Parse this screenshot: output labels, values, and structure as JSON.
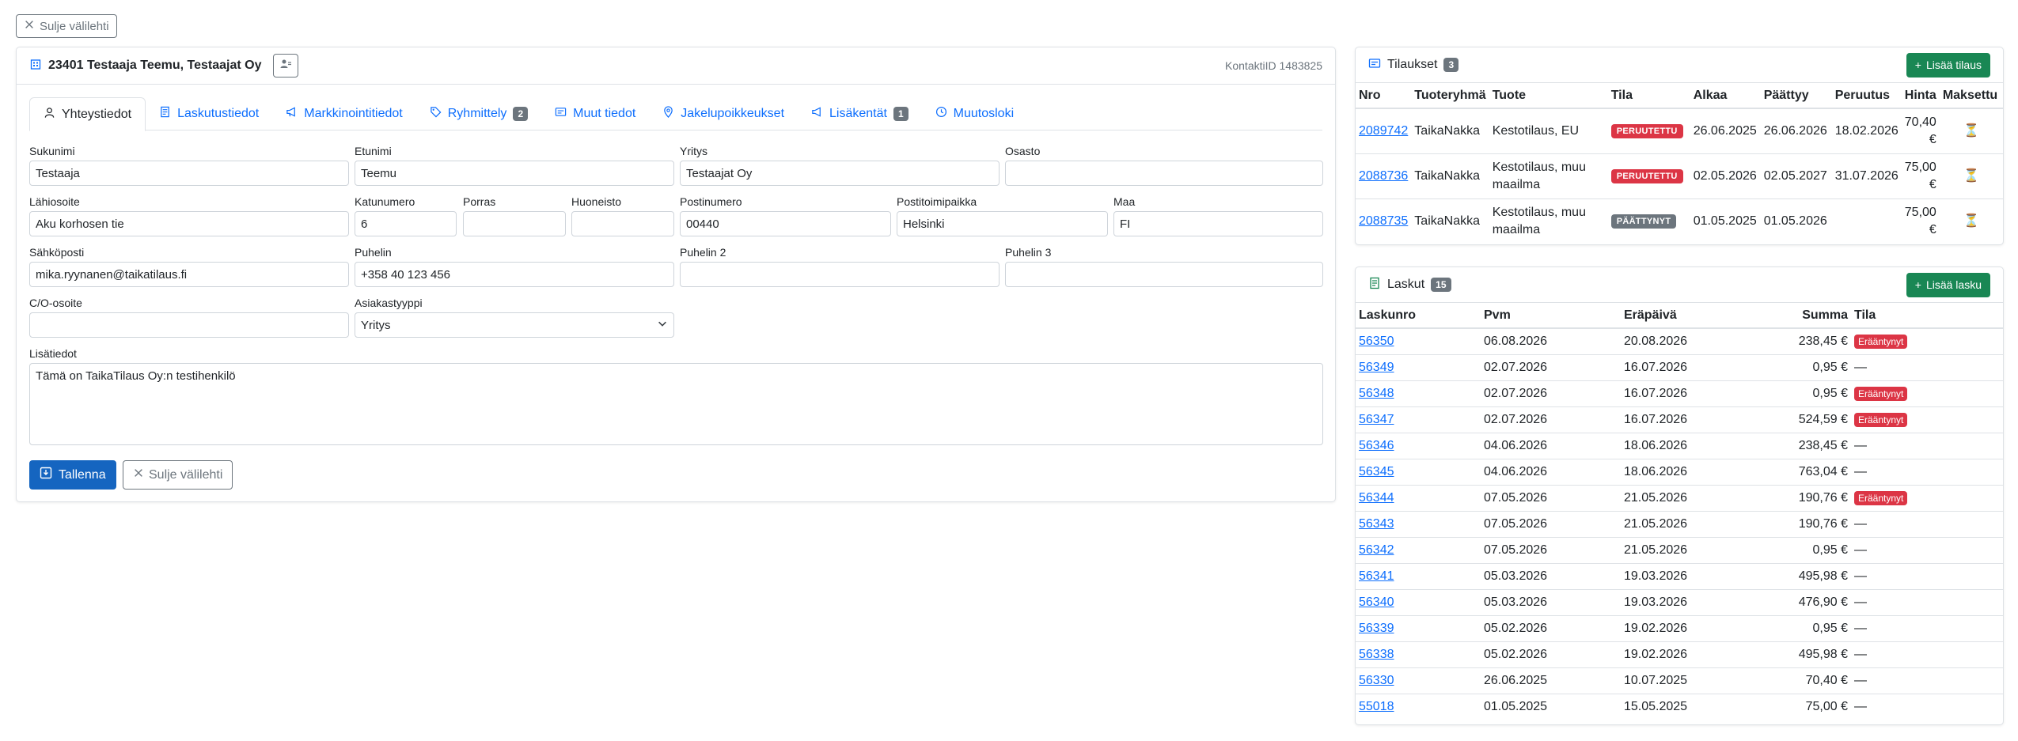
{
  "top_close_label": "Sulje välilehti",
  "contact": {
    "title": "23401 Testaaja Teemu, Testaajat Oy",
    "contact_id": "KontaktiID 1483825"
  },
  "tabs": [
    {
      "label": "Yhteystiedot",
      "icon": "person-icon",
      "active": true
    },
    {
      "label": "Laskutustiedot",
      "icon": "invoice-icon"
    },
    {
      "label": "Markkinointitiedot",
      "icon": "megaphone-icon"
    },
    {
      "label": "Ryhmittely",
      "icon": "tag-icon",
      "badge": "2"
    },
    {
      "label": "Muut tiedot",
      "icon": "card-icon"
    },
    {
      "label": "Jakelupoikkeukset",
      "icon": "location-icon"
    },
    {
      "label": "Lisäkentät",
      "icon": "megaphone-icon",
      "badge": "1"
    },
    {
      "label": "Muutosloki",
      "icon": "clock-icon"
    }
  ],
  "fields": {
    "sukunimi": {
      "label": "Sukunimi",
      "value": "Testaaja"
    },
    "etunimi": {
      "label": "Etunimi",
      "value": "Teemu"
    },
    "yritys": {
      "label": "Yritys",
      "value": "Testaajat Oy"
    },
    "osasto": {
      "label": "Osasto",
      "value": ""
    },
    "lahiosoite": {
      "label": "Lähiosoite",
      "value": "Aku korhosen tie"
    },
    "katunumero": {
      "label": "Katunumero",
      "value": "6"
    },
    "porras": {
      "label": "Porras",
      "value": ""
    },
    "huoneisto": {
      "label": "Huoneisto",
      "value": ""
    },
    "postinumero": {
      "label": "Postinumero",
      "value": "00440"
    },
    "postitoimipaikka": {
      "label": "Postitoimipaikka",
      "value": "Helsinki"
    },
    "maa": {
      "label": "Maa",
      "value": "FI"
    },
    "sahkoposti": {
      "label": "Sähköposti",
      "value": "mika.ryynanen@taikatilaus.fi"
    },
    "puhelin": {
      "label": "Puhelin",
      "value": "+358 40 123 456"
    },
    "puhelin2": {
      "label": "Puhelin 2",
      "value": ""
    },
    "puhelin3": {
      "label": "Puhelin 3",
      "value": ""
    },
    "co_osoite": {
      "label": "C/O-osoite",
      "value": ""
    },
    "asiakastyyppi": {
      "label": "Asiakastyyppi",
      "value": "Yritys"
    },
    "lisatiedot": {
      "label": "Lisätiedot",
      "value": "Tämä on TaikaTilaus Oy:n testihenkilö"
    }
  },
  "buttons": {
    "save": "Tallenna",
    "close": "Sulje välilehti"
  },
  "orders": {
    "title": "Tilaukset",
    "count": "3",
    "add_label": "Lisää tilaus",
    "columns": [
      "Nro",
      "Tuoteryhmä",
      "Tuote",
      "Tila",
      "Alkaa",
      "Päättyy",
      "Peruutus",
      "Hinta",
      "Maksettu"
    ],
    "rows": [
      {
        "nro": "2089742",
        "group": "TaikaNakka",
        "product": "Kestotilaus, EU",
        "status": "PERUUTETTU",
        "status_type": "danger",
        "start": "26.06.2025",
        "end": "26.06.2026",
        "cancel": "18.02.2026",
        "price": "70,40 €"
      },
      {
        "nro": "2088736",
        "group": "TaikaNakka",
        "product": "Kestotilaus, muu maailma",
        "status": "PERUUTETTU",
        "status_type": "danger",
        "start": "02.05.2026",
        "end": "02.05.2027",
        "cancel": "31.07.2026",
        "price": "75,00 €"
      },
      {
        "nro": "2088735",
        "group": "TaikaNakka",
        "product": "Kestotilaus, muu maailma",
        "status": "PÄÄTTYNYT",
        "status_type": "secondary",
        "start": "01.05.2025",
        "end": "01.05.2026",
        "cancel": "",
        "price": "75,00 €"
      }
    ]
  },
  "invoices": {
    "title": "Laskut",
    "count": "15",
    "add_label": "Lisää lasku",
    "columns": [
      "Laskunro",
      "Pvm",
      "Eräpäivä",
      "Summa",
      "Tila"
    ],
    "overdue_label": "Erääntynyt",
    "rows": [
      {
        "nro": "56350",
        "date": "06.08.2026",
        "due": "20.08.2026",
        "sum": "238,45 €",
        "status": "Erääntynyt"
      },
      {
        "nro": "56349",
        "date": "02.07.2026",
        "due": "16.07.2026",
        "sum": "0,95 €",
        "status": "—"
      },
      {
        "nro": "56348",
        "date": "02.07.2026",
        "due": "16.07.2026",
        "sum": "0,95 €",
        "status": "Erääntynyt"
      },
      {
        "nro": "56347",
        "date": "02.07.2026",
        "due": "16.07.2026",
        "sum": "524,59 €",
        "status": "Erääntynyt"
      },
      {
        "nro": "56346",
        "date": "04.06.2026",
        "due": "18.06.2026",
        "sum": "238,45 €",
        "status": "—"
      },
      {
        "nro": "56345",
        "date": "04.06.2026",
        "due": "18.06.2026",
        "sum": "763,04 €",
        "status": "—"
      },
      {
        "nro": "56344",
        "date": "07.05.2026",
        "due": "21.05.2026",
        "sum": "190,76 €",
        "status": "Erääntynyt"
      },
      {
        "nro": "56343",
        "date": "07.05.2026",
        "due": "21.05.2026",
        "sum": "190,76 €",
        "status": "—"
      },
      {
        "nro": "56342",
        "date": "07.05.2026",
        "due": "21.05.2026",
        "sum": "0,95 €",
        "status": "—"
      },
      {
        "nro": "56341",
        "date": "05.03.2026",
        "due": "19.03.2026",
        "sum": "495,98 €",
        "status": "—"
      },
      {
        "nro": "56340",
        "date": "05.03.2026",
        "due": "19.03.2026",
        "sum": "476,90 €",
        "status": "—"
      },
      {
        "nro": "56339",
        "date": "05.02.2026",
        "due": "19.02.2026",
        "sum": "0,95 €",
        "status": "—"
      },
      {
        "nro": "56338",
        "date": "05.02.2026",
        "due": "19.02.2026",
        "sum": "495,98 €",
        "status": "—"
      },
      {
        "nro": "56330",
        "date": "26.06.2025",
        "due": "10.07.2025",
        "sum": "70,40 €",
        "status": "—"
      },
      {
        "nro": "55018",
        "date": "01.05.2025",
        "due": "15.05.2025",
        "sum": "75,00 €",
        "status": "—"
      }
    ]
  },
  "colors": {
    "primary": "#0d6efd",
    "save": "#1565c0",
    "success": "#198754",
    "danger": "#dc3545",
    "secondary": "#6c757d"
  }
}
